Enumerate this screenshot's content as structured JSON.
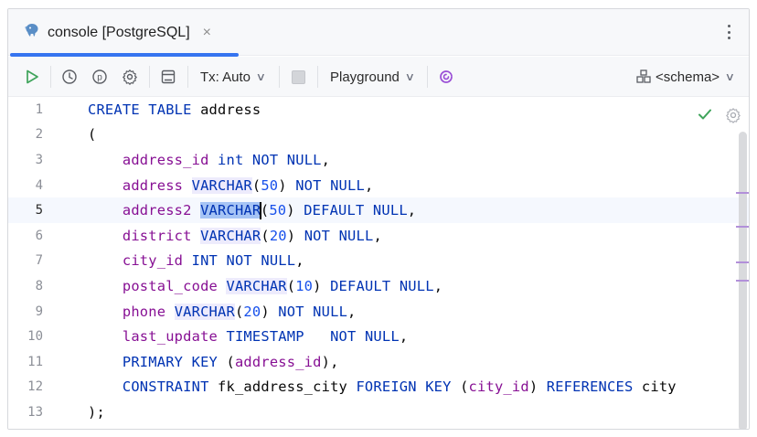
{
  "tab": {
    "title": "console [PostgreSQL]",
    "close_glyph": "×",
    "icon": "postgresql-elephant-icon"
  },
  "toolbar": {
    "tx_label": "Tx: Auto",
    "playground_label": "Playground",
    "schema_label": "<schema>",
    "icons": [
      "execute-icon",
      "history-icon",
      "parameters-icon",
      "settings-icon",
      "output-layout-icon",
      "stop-icon",
      "ai-assistant-icon",
      "schema-icon"
    ]
  },
  "editor": {
    "line_numbers": [
      "1",
      "2",
      "3",
      "4",
      "5",
      "6",
      "7",
      "8",
      "9",
      "10",
      "11",
      "12",
      "13"
    ],
    "current_line": 5,
    "lines": {
      "l1": {
        "a": "CREATE",
        "b": " ",
        "c": "TABLE",
        "d": " address"
      },
      "l2": {
        "a": "("
      },
      "l3": {
        "a": "    ",
        "b": "address_id",
        "c": " ",
        "d": "int",
        "e": " ",
        "f": "NOT",
        "g": " ",
        "h": "NULL",
        "i": ","
      },
      "l4": {
        "a": "    ",
        "b": "address",
        "c": " ",
        "d": "VARCHAR",
        "e": "(",
        "f": "50",
        "g": ") ",
        "h": "NOT",
        "i": " ",
        "j": "NULL",
        "k": ","
      },
      "l5": {
        "a": "    ",
        "b": "address2",
        "c": " ",
        "d": "VARCHAR",
        "e": "(",
        "f": "50",
        "g": ") ",
        "h": "DEFAULT",
        "i": " ",
        "j": "NULL",
        "k": ","
      },
      "l6": {
        "a": "    ",
        "b": "district",
        "c": " ",
        "d": "VARCHAR",
        "e": "(",
        "f": "20",
        "g": ") ",
        "h": "NOT",
        "i": " ",
        "j": "NULL",
        "k": ","
      },
      "l7": {
        "a": "    ",
        "b": "city_id",
        "c": " ",
        "d": "INT",
        "e": " ",
        "f": "NOT",
        "g": " ",
        "h": "NULL",
        "i": ","
      },
      "l8": {
        "a": "    ",
        "b": "postal_code",
        "c": " ",
        "d": "VARCHAR",
        "e": "(",
        "f": "10",
        "g": ") ",
        "h": "DEFAULT",
        "i": " ",
        "j": "NULL",
        "k": ","
      },
      "l9": {
        "a": "    ",
        "b": "phone",
        "c": " ",
        "d": "VARCHAR",
        "e": "(",
        "f": "20",
        "g": ") ",
        "h": "NOT",
        "i": " ",
        "j": "NULL",
        "k": ","
      },
      "l10": {
        "a": "    ",
        "b": "last_update",
        "c": " ",
        "d": "TIMESTAMP",
        "e": "   ",
        "f": "NOT",
        "g": " ",
        "h": "NULL",
        "i": ","
      },
      "l11": {
        "a": "    ",
        "b": "PRIMARY",
        "c": " ",
        "d": "KEY",
        "e": " (",
        "f": "address_id",
        "g": "),"
      },
      "l12": {
        "a": "    ",
        "b": "CONSTRAINT",
        "c": " fk_address_city ",
        "d": "FOREIGN",
        "e": " ",
        "f": "KEY",
        "g": " (",
        "h": "city_id",
        "i": ") ",
        "j": "REFERENCES",
        "k": " city"
      },
      "l13": {
        "a": ");"
      }
    },
    "status_icons": [
      "inspection-ok-icon",
      "gear-icon"
    ]
  },
  "colors": {
    "keyword": "#0033b3",
    "column": "#871094",
    "number": "#1750eb",
    "accent": "#3574f0",
    "run_green": "#3fa45b",
    "ai_purple": "#9a4fd6",
    "current_line": "#f5f8fe",
    "selection": "#a6c4f5"
  }
}
